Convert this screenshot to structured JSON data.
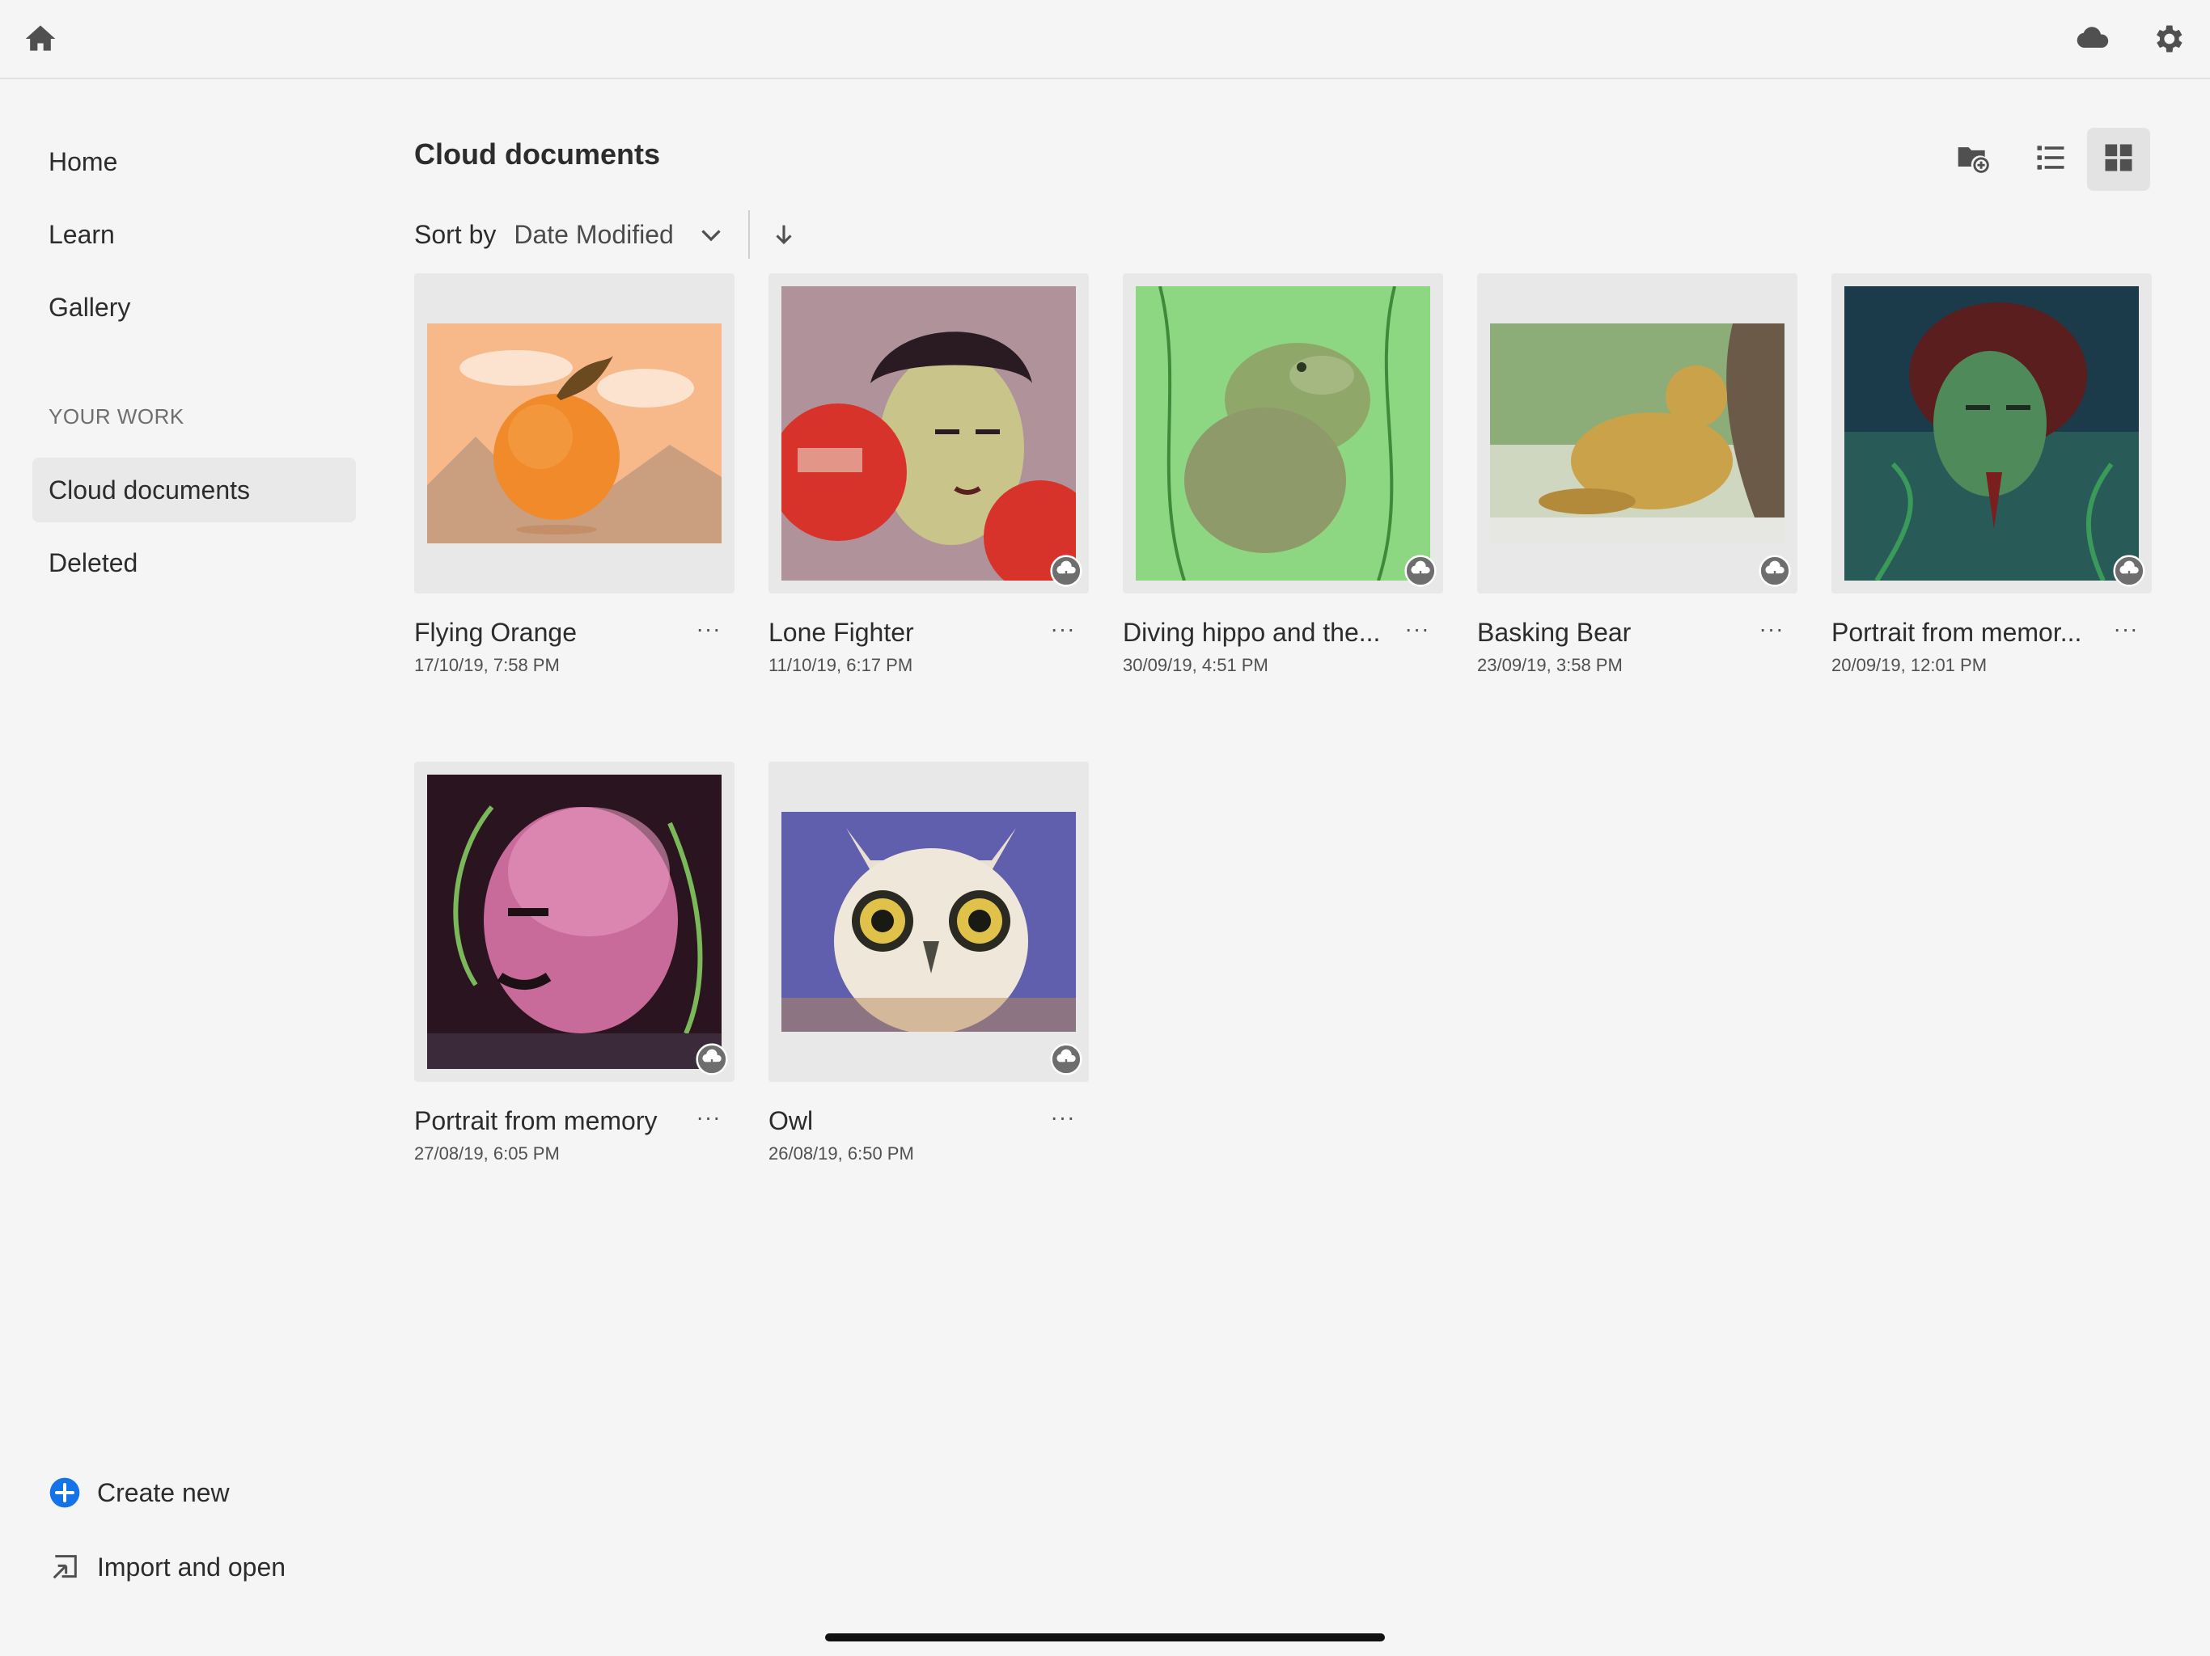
{
  "nav": {
    "items": [
      {
        "label": "Home"
      },
      {
        "label": "Learn"
      },
      {
        "label": "Gallery"
      }
    ],
    "section_label": "YOUR WORK",
    "work_items": [
      {
        "label": "Cloud documents"
      },
      {
        "label": "Deleted"
      }
    ],
    "create_new": "Create new",
    "import_open": "Import and open"
  },
  "main": {
    "title": "Cloud documents",
    "sort_label": "Sort by",
    "sort_value": "Date Modified"
  },
  "documents": [
    {
      "title": "Flying Orange",
      "date": "17/10/19, 7:58 PM"
    },
    {
      "title": "Lone Fighter",
      "date": "11/10/19, 6:17 PM"
    },
    {
      "title": "Diving hippo and the...",
      "date": "30/09/19, 4:51 PM"
    },
    {
      "title": "Basking Bear",
      "date": "23/09/19, 3:58 PM"
    },
    {
      "title": "Portrait from memor...",
      "date": "20/09/19, 12:01 PM"
    },
    {
      "title": "Portrait from memory",
      "date": "27/08/19, 6:05 PM"
    },
    {
      "title": "Owl",
      "date": "26/08/19, 6:50 PM"
    }
  ],
  "more_label": "···",
  "colors": {
    "background": "#f5f5f5",
    "accent": "#1473e6",
    "active_nav": "#e9e9e9",
    "thumb_bg": "#e8e8e8"
  },
  "icons": [
    "home-icon",
    "cloud-icon",
    "gear-icon",
    "new-folder-icon",
    "list-view-icon",
    "grid-view-icon",
    "chevron-down-icon",
    "arrow-down-icon",
    "plus-circle-icon",
    "import-icon",
    "cloud-badge-icon"
  ]
}
